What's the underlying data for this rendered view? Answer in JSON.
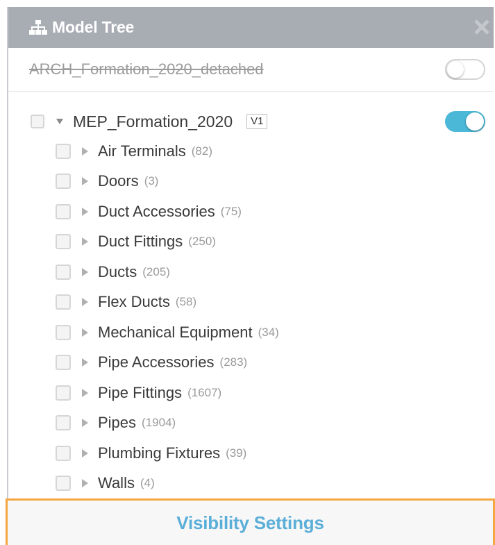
{
  "header": {
    "title": "Model Tree",
    "icon": "tree-icon",
    "close_icon": "close-icon",
    "background": "#a8acb3"
  },
  "detached_model": {
    "name": "ARCH_Formation_2020_detached",
    "visible": false
  },
  "model": {
    "name": "MEP_Formation_2020",
    "version": "V1",
    "visible": true,
    "expanded": true,
    "children": [
      {
        "label": "Air Terminals",
        "count": "(82)"
      },
      {
        "label": "Doors",
        "count": "(3)"
      },
      {
        "label": "Duct Accessories",
        "count": "(75)"
      },
      {
        "label": "Duct Fittings",
        "count": "(250)"
      },
      {
        "label": "Ducts",
        "count": "(205)"
      },
      {
        "label": "Flex Ducts",
        "count": "(58)"
      },
      {
        "label": "Mechanical Equipment",
        "count": "(34)"
      },
      {
        "label": "Pipe Accessories",
        "count": "(283)"
      },
      {
        "label": "Pipe Fittings",
        "count": "(1607)"
      },
      {
        "label": "Pipes",
        "count": "(1904)"
      },
      {
        "label": "Plumbing Fixtures",
        "count": "(39)"
      },
      {
        "label": "Walls",
        "count": "(4)"
      }
    ]
  },
  "footer": {
    "button_label": "Visibility Settings",
    "accent": "#5aaed8",
    "highlight_border": "#f4a640"
  },
  "colors": {
    "toggle_on": "#4bb8d8"
  }
}
